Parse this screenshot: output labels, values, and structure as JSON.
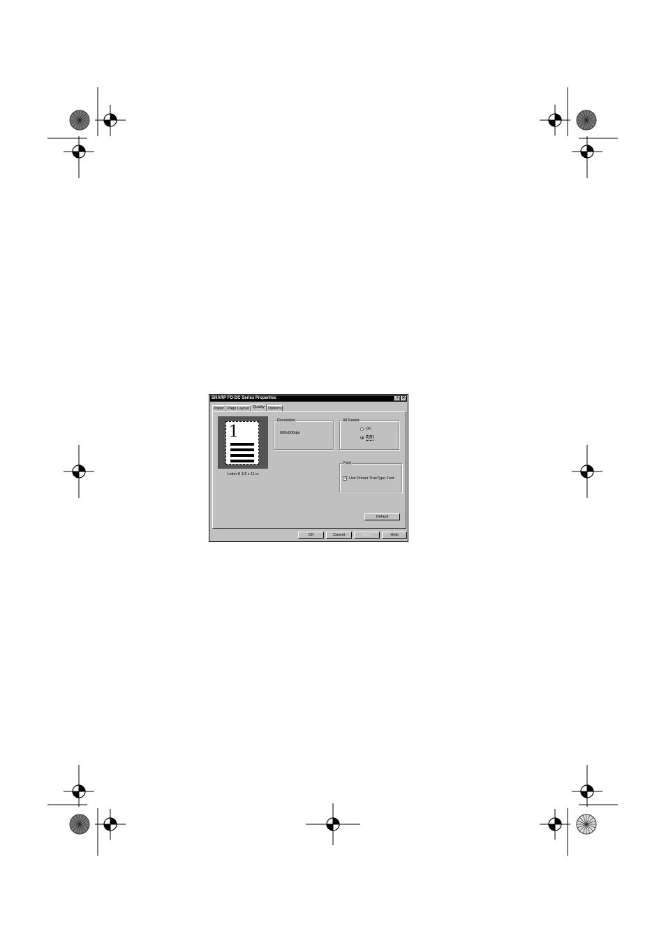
{
  "dialog": {
    "title": "SHARP FO-DC Series  Properties",
    "help_btn": "?",
    "close_btn": "✕",
    "tabs": [
      {
        "label": "Paper"
      },
      {
        "label": "Page Layout"
      },
      {
        "label": "Quality"
      },
      {
        "label": "Options"
      }
    ],
    "active_tab": "Quality",
    "preview": {
      "page_number": "1",
      "paper_size": "Letter 8 1/2 x 11 in"
    },
    "resolution": {
      "label": "Resolution",
      "value": "600x600dpi"
    },
    "all_raster": {
      "label": "All Raster",
      "options": [
        {
          "label": "On",
          "selected": false
        },
        {
          "label": "Off",
          "selected": true
        }
      ]
    },
    "font": {
      "label": "Font",
      "use_truetype_label": "Use Printer TrueType Font",
      "use_truetype_checked": true,
      "check_mark": "✓"
    },
    "default_button": "Default",
    "buttons": {
      "ok": "OK",
      "cancel": "Cancel",
      "apply": "Apply",
      "help": "Help"
    }
  },
  "colors": {
    "dialog_bg": "#c0c0c0",
    "titlebar_bg": "#000000"
  }
}
